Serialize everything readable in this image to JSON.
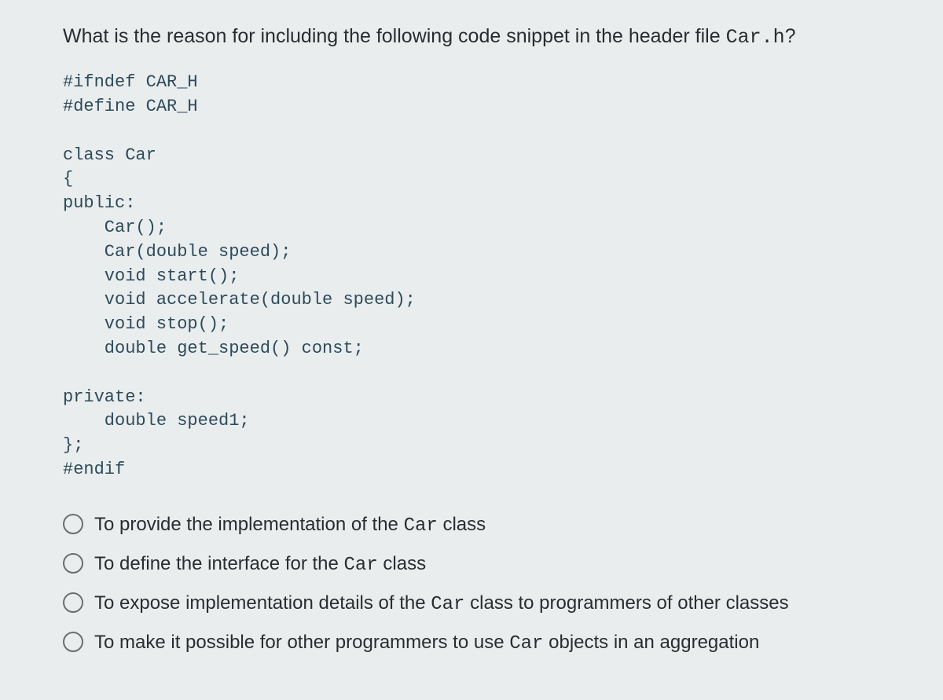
{
  "question": {
    "part1": "What is the reason for including the following code snippet in the header file ",
    "filename": "Car.h",
    "part2": "?"
  },
  "code": "#ifndef CAR_H\n#define CAR_H\n\nclass Car\n{\npublic:\n    Car();\n    Car(double speed);\n    void start();\n    void accelerate(double speed);\n    void stop();\n    double get_speed() const;\n\nprivate:\n    double speed1;\n};\n#endif",
  "answers": [
    {
      "pre": "To provide the implementation of the ",
      "mono": "Car",
      "post": " class"
    },
    {
      "pre": "To define the interface for the ",
      "mono": "Car",
      "post": " class"
    },
    {
      "pre": "To expose implementation details of the ",
      "mono": "Car",
      "post": " class to programmers of other classes"
    },
    {
      "pre": "To make it possible for other programmers to use ",
      "mono": "Car",
      "post": " objects in an aggregation"
    }
  ]
}
